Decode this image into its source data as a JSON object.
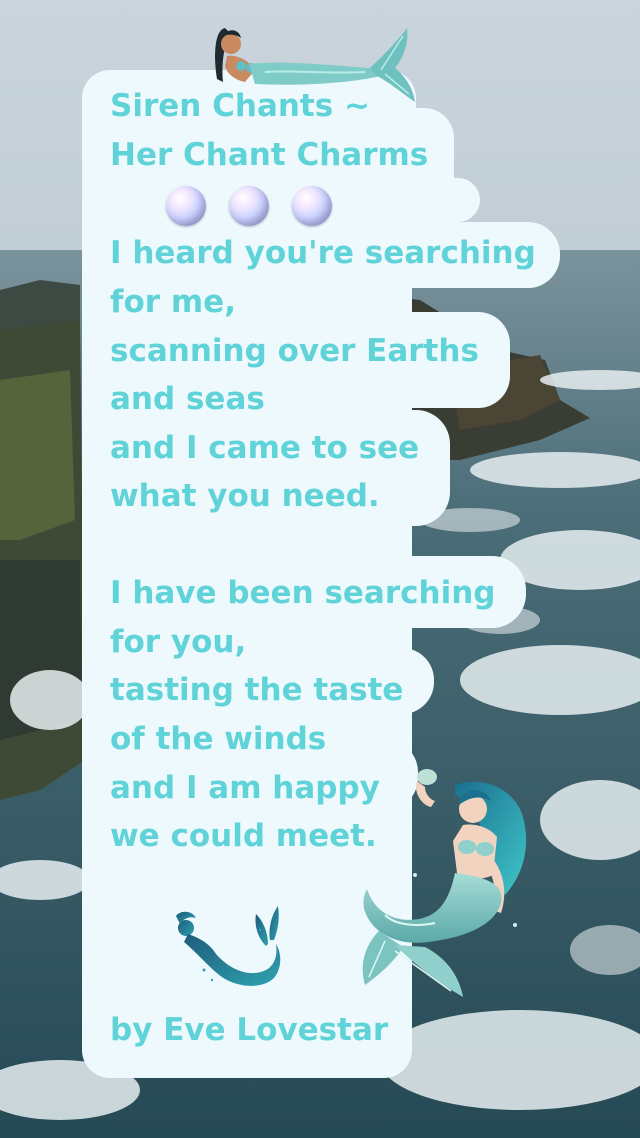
{
  "poem": {
    "title_line1": "Siren Chants ~",
    "title_line2": "Her Chant Charms",
    "stanza1": [
      "I heard you're searching",
      "for me,",
      "scanning over Earths",
      "and seas",
      "and I came to see",
      "what you need."
    ],
    "stanza2": [
      "I have been searching",
      "for you,",
      "tasting the taste",
      "of the winds",
      "and I am happy",
      "we could meet."
    ],
    "author": "by Eve Lovestar"
  },
  "decorations": {
    "pearls": 3,
    "icons": [
      "reclining-mermaid-icon",
      "mermaid-silhouette-icon",
      "mermaid-holding-pearl-icon"
    ]
  },
  "colors": {
    "text": "#5fd3d8",
    "card": "#eef9fd",
    "sea": "#2c5560"
  }
}
